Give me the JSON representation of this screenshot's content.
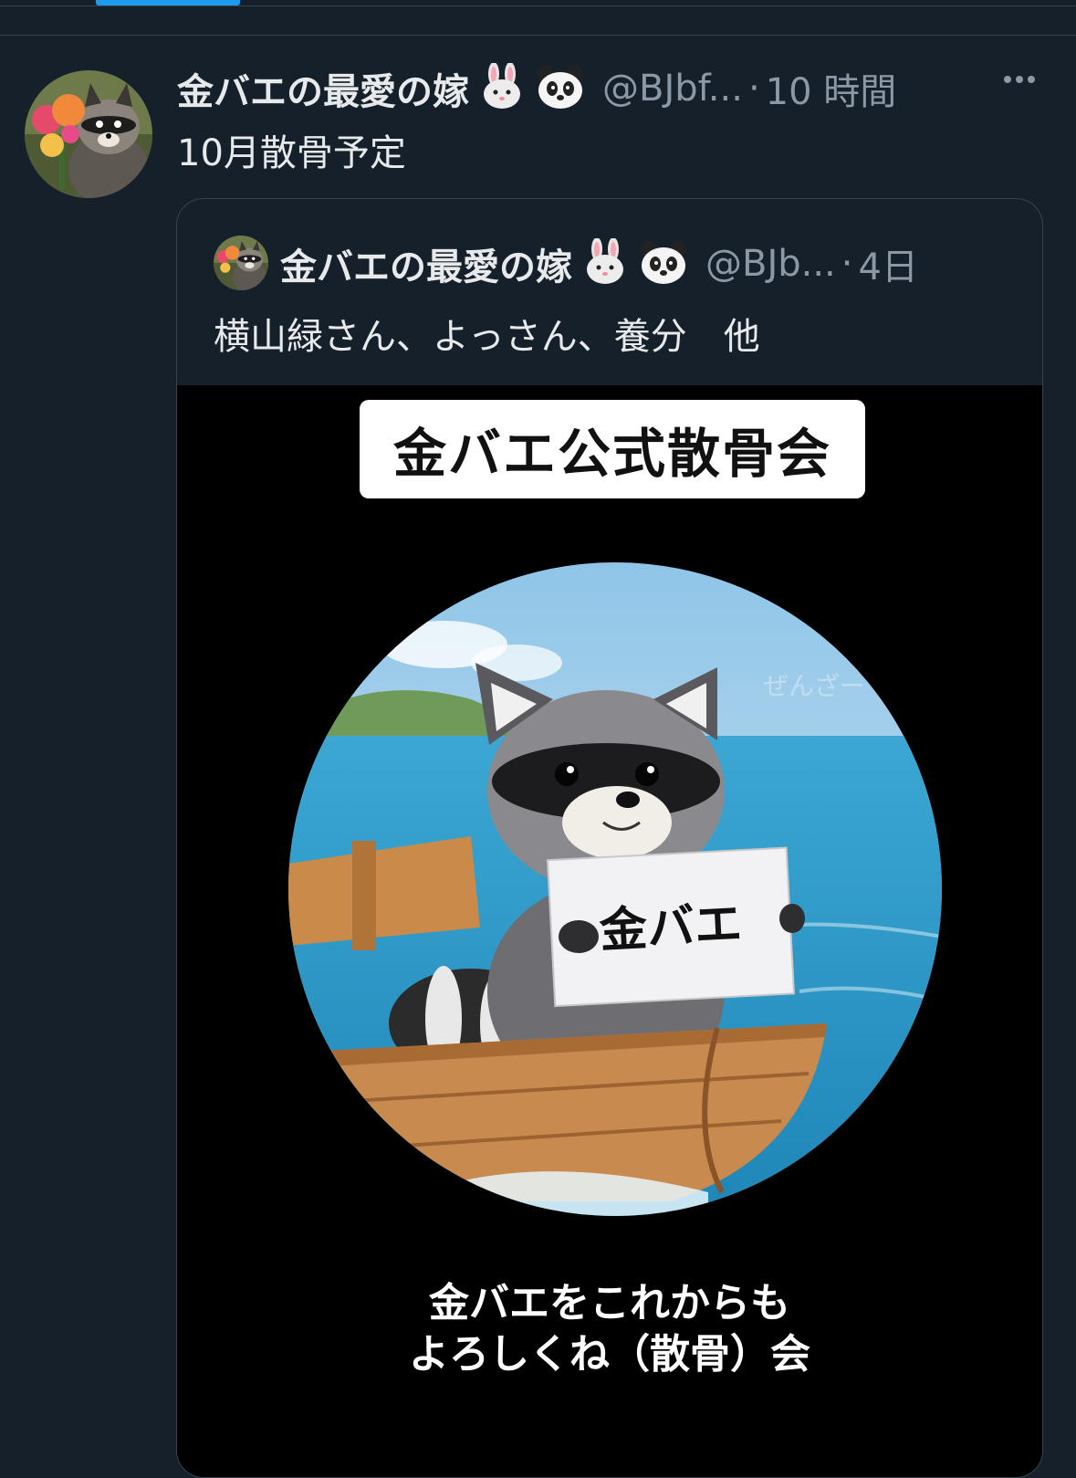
{
  "post": {
    "author_name": "金バエの最愛の嫁",
    "author_emojis": [
      "rabbit-face-icon",
      "panda-face-icon"
    ],
    "handle": "@BJbf...",
    "separator": "·",
    "time": "10 時間",
    "text": "10月散骨予定"
  },
  "quoted_post": {
    "author_name": "金バエの最愛の嫁",
    "author_emojis": [
      "rabbit-face-icon",
      "panda-face-icon"
    ],
    "handle": "@BJb...",
    "separator": "·",
    "time": "4日",
    "text": "横山緑さん、よっさん、養分　他",
    "media": {
      "title": "金バエ公式散骨会",
      "sign_text": "金バエ",
      "watermark": "ぜんざー",
      "caption_line1": "金バエをこれからも",
      "caption_line2": "よろしくね（散骨）会"
    }
  },
  "colors": {
    "background": "#15202b",
    "text_primary": "#e7e9ea",
    "text_secondary": "#8b98a5",
    "border": "#38444d",
    "accent": "#1d9bf0"
  }
}
